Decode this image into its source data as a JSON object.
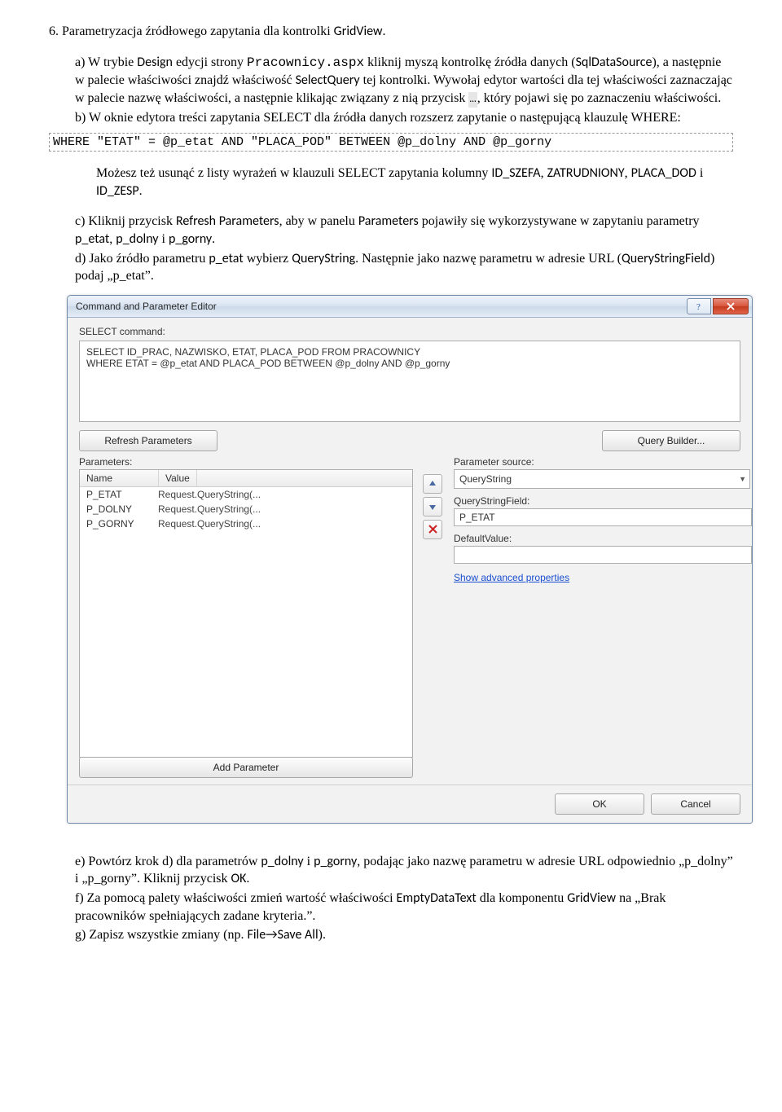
{
  "doc": {
    "heading": "6.  Parametryzacja źródłowego zapytania dla kontrolki ",
    "heading_code": "GridView",
    "heading_tail": ".",
    "a_pre": "a)   W trybie ",
    "a_design": "Design",
    "a_mid1": " edycji strony ",
    "a_mono": "Pracownicy.aspx",
    "a_mid2": " kliknij myszą kontrolkę źródła danych (",
    "a_sql": "SqlDataSource",
    "a_mid3": "), a następnie w palecie właściwości znajdź właściwość ",
    "a_selq": "SelectQuery",
    "a_mid4": " tej kontrolki. Wywołaj edytor wartości dla tej właściwości zaznaczając w palecie nazwę właściwości, a następnie klikając związany z nią przycisk ",
    "a_ell": "…",
    "a_mid5": ", który pojawi się po zaznaczeniu właściwości.",
    "b": "b)   W oknie edytora treści zapytania SELECT dla źródła danych rozszerz zapytanie o następującą klauzulę WHERE:",
    "codebox": "WHERE \"ETAT\" = @p_etat AND \"PLACA_POD\" BETWEEN @p_dolny AND @p_gorny",
    "after1": "Możesz też usunąć z listy wyrażeń w klauzuli SELECT zapytania kolumny ",
    "after1_a": "ID_SZEFA",
    "after1_b": "ZATRUDNIONY",
    "after1_c": "PLACA_DOD",
    "after1_d": "ID_ZESP",
    "after1_tail": ".",
    "c_pre": "c)   Kliknij przycisk ",
    "c_btn": "Refresh Parameters",
    "c_mid1": ", aby w panelu ",
    "c_params": "Parameters",
    "c_mid2": " pojawiły się wykorzystywane w zapytaniu parametry ",
    "c_p1": "p_etat",
    "c_p2": "p_dolny",
    "c_p3": "p_gorny",
    "c_tail": ".",
    "d_pre": "d)   Jako źródło parametru ",
    "d_p": "p_etat",
    "d_mid1": " wybierz ",
    "d_qs": "QueryString",
    "d_mid2": ". Następnie jako nazwę parametru w adresie URL (",
    "d_qsf": "QueryStringField",
    "d_mid3": ") podaj „p_etat”.",
    "e_pre": "e)   Powtórz krok d) dla parametrów ",
    "e_p1": "p_dolny",
    "e_p2": "p_gorny",
    "e_mid": ", podając jako nazwę parametru w adresie URL odpowiednio „p_dolny” i „p_gorny”. Kliknij przycisk ",
    "e_ok": "OK",
    "e_tail": ".",
    "f_pre": "f)   Za pomocą palety właściwości zmień wartość właściwości ",
    "f_empty": "EmptyDataText",
    "f_mid": " dla komponentu ",
    "f_gv": "GridView",
    "f_tail": " na „Brak pracowników spełniających zadane kryteria.”.",
    "g_pre": "g)   Zapisz wszystkie zmiany (np. ",
    "g_menu": "File→Save All",
    "g_tail": ")."
  },
  "win": {
    "title": "Command and Parameter Editor",
    "select_label": "SELECT command:",
    "sql_line1": "SELECT ID_PRAC, NAZWISKO, ETAT, PLACA_POD FROM PRACOWNICY",
    "sql_line2": "WHERE ETAT = @p_etat AND PLACA_POD BETWEEN @p_dolny AND @p_gorny",
    "refresh": "Refresh Parameters",
    "qbuilder": "Query Builder...",
    "params_label": "Parameters:",
    "psource_label": "Parameter source:",
    "col_name": "Name",
    "col_value": "Value",
    "rows": [
      {
        "name": "P_ETAT",
        "value": "Request.QueryString(..."
      },
      {
        "name": "P_DOLNY",
        "value": "Request.QueryString(..."
      },
      {
        "name": "P_GORNY",
        "value": "Request.QueryString(..."
      }
    ],
    "psource_value": "QueryString",
    "qsf_label": "QueryStringField:",
    "qsf_value": "P_ETAT",
    "defv_label": "DefaultValue:",
    "defv_value": "",
    "adv_link": "Show advanced properties",
    "addparam": "Add Parameter",
    "ok": "OK",
    "cancel": "Cancel"
  }
}
